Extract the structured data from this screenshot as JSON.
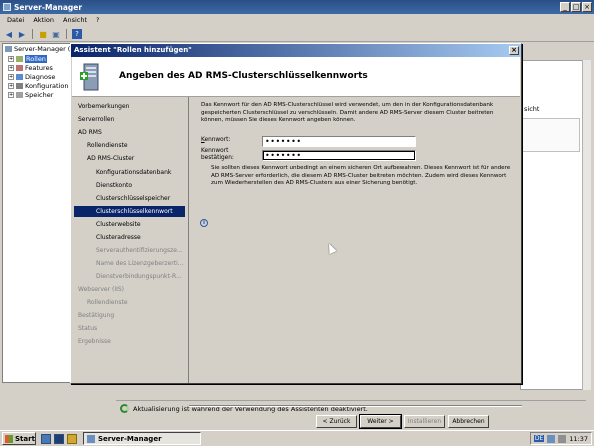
{
  "main_window": {
    "title": "Server-Manager",
    "minimize": "_",
    "maximize": "□",
    "close": "×"
  },
  "menu": [
    "Datei",
    "Aktion",
    "Ansicht",
    "?"
  ],
  "tree": {
    "root": "Server-Manager (A",
    "items": [
      "Rollen",
      "Features",
      "Diagnose",
      "Konfiguration",
      "Speicher"
    ]
  },
  "right_pane": {
    "link": "sicht"
  },
  "status_bar": {
    "text": "Aktualisierung ist während der Verwendung des Assistenten deaktiviert."
  },
  "dialog": {
    "title": "Assistent \"Rollen hinzufügen\"",
    "close": "×",
    "header": "Angeben des AD RMS-Clusterschlüsselkennworts",
    "nav": [
      {
        "label": "Vorbemerkungen",
        "state": "normal",
        "indent": 0
      },
      {
        "label": "Serverrollen",
        "state": "normal",
        "indent": 0
      },
      {
        "label": "AD RMS",
        "state": "normal",
        "indent": 0
      },
      {
        "label": "Rollendienste",
        "state": "normal",
        "indent": 1
      },
      {
        "label": "AD RMS-Cluster",
        "state": "normal",
        "indent": 1
      },
      {
        "label": "Konfigurationsdatenbank",
        "state": "normal",
        "indent": 2
      },
      {
        "label": "Dienstkonto",
        "state": "normal",
        "indent": 2
      },
      {
        "label": "Clusterschlüsselspeicher",
        "state": "normal",
        "indent": 2
      },
      {
        "label": "Clusterschlüsselkennwort",
        "state": "active",
        "indent": 2
      },
      {
        "label": "Clusterwebsite",
        "state": "normal",
        "indent": 2
      },
      {
        "label": "Clusteradresse",
        "state": "normal",
        "indent": 2
      },
      {
        "label": "Serverauthentifizierungsze...",
        "state": "disabled",
        "indent": 2
      },
      {
        "label": "Name des Lizenzgeberzerti...",
        "state": "disabled",
        "indent": 2
      },
      {
        "label": "Dienstverbindungspunkt-R...",
        "state": "disabled",
        "indent": 2
      },
      {
        "label": "Webserver (IIS)",
        "state": "disabled",
        "indent": 0
      },
      {
        "label": "Rollendienste",
        "state": "disabled",
        "indent": 1
      },
      {
        "label": "Bestätigung",
        "state": "disabled",
        "indent": 0
      },
      {
        "label": "Status",
        "state": "disabled",
        "indent": 0
      },
      {
        "label": "Ergebnisse",
        "state": "disabled",
        "indent": 0
      }
    ],
    "description": "Das Kennwort für den AD RMS-Clusterschlüssel wird verwendet, um den in der Konfigurationsdatenbank gespeicherten Clusterschlüssel zu verschlüsseln. Damit andere AD RMS-Server diesem Cluster beitreten können, müssen Sie dieses Kennwort angeben können.",
    "password_label": "Kennwort:",
    "password_value": "•••••••",
    "confirm_label_1": "Kennwort",
    "confirm_label_2": "bestätigen:",
    "confirm_value": "•••••••",
    "info": "Sie sollten dieses Kennwort unbedingt an einem sicheren Ort aufbewahren. Dieses Kennwort ist für andere AD RMS-Server erforderlich, die diesem AD RMS-Cluster beitreten möchten. Zudem wird dieses Kennwort zum Wiederherstellen des AD RMS-Clusters aus einer Sicherung benötigt.",
    "buttons": {
      "back": "< Zurück",
      "next": "Weiter >",
      "install": "Installieren",
      "cancel": "Abbrechen"
    }
  },
  "taskbar": {
    "start": "Start",
    "task": "Server-Manager",
    "lang": "DE",
    "clock": "11:37"
  }
}
